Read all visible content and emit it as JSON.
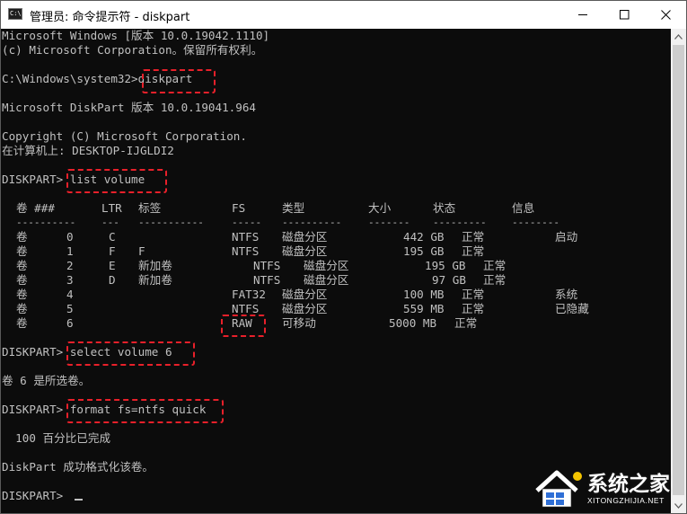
{
  "window": {
    "title": "管理员: 命令提示符 - diskpart",
    "icon_label": "C:\\"
  },
  "console": {
    "lines": [
      "Microsoft Windows [版本 10.0.19042.1110]",
      "(c) Microsoft Corporation。保留所有权利。",
      "C:\\Windows\\system32>diskpart",
      "Microsoft DiskPart 版本 10.0.19041.964",
      "Copyright (C) Microsoft Corporation.",
      "在计算机上: DESKTOP-IJGLDI2",
      "DISKPART> list volume",
      "DISKPART> select volume 6",
      "卷 6 是所选卷。",
      "DISKPART> format fs=ntfs quick",
      "  100 百分比已完成",
      "DiskPart 成功格式化该卷。",
      "DISKPART> "
    ],
    "volume_table": {
      "headers": [
        "卷 ###",
        "LTR",
        "标签",
        "FS",
        "类型",
        "大小",
        "状态",
        "信息"
      ],
      "separators": [
        "----------",
        "---",
        "-----------",
        "-----",
        "----------",
        "-------",
        "---------",
        "--------"
      ],
      "rows": [
        {
          "vol": "卷",
          "num": "0",
          "ltr": "C",
          "label": "",
          "fs": "NTFS",
          "type": "磁盘分区",
          "size": "442 GB",
          "status": "正常",
          "info": "启动"
        },
        {
          "vol": "卷",
          "num": "1",
          "ltr": "F",
          "label": "F",
          "fs": "NTFS",
          "type": "磁盘分区",
          "size": "195 GB",
          "status": "正常",
          "info": ""
        },
        {
          "vol": "卷",
          "num": "2",
          "ltr": "E",
          "label": "新加卷",
          "fs": "NTFS",
          "type": "磁盘分区",
          "size": "195 GB",
          "status": "正常",
          "info": ""
        },
        {
          "vol": "卷",
          "num": "3",
          "ltr": "D",
          "label": "新加卷",
          "fs": "NTFS",
          "type": "磁盘分区",
          "size": "97 GB",
          "status": "正常",
          "info": ""
        },
        {
          "vol": "卷",
          "num": "4",
          "ltr": "",
          "label": "",
          "fs": "FAT32",
          "type": "磁盘分区",
          "size": "100 MB",
          "status": "正常",
          "info": "系统"
        },
        {
          "vol": "卷",
          "num": "5",
          "ltr": "",
          "label": "",
          "fs": "NTFS",
          "type": "磁盘分区",
          "size": "559 MB",
          "status": "正常",
          "info": "已隐藏"
        },
        {
          "vol": "卷",
          "num": "6",
          "ltr": "",
          "label": "",
          "fs": "RAW",
          "type": "可移动",
          "size": "5000 MB",
          "status": "正常",
          "info": ""
        }
      ]
    }
  },
  "watermark": {
    "text": "系统之家",
    "url": "XITONGZHIJIA.NET"
  },
  "colors": {
    "console_bg": "#0c0c0c",
    "console_fg": "#c0c0c0",
    "highlight": "#e8202a"
  }
}
